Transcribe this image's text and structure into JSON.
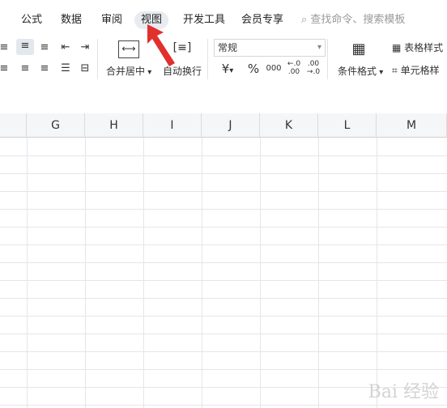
{
  "tabs": [
    {
      "label": "公式"
    },
    {
      "label": "数据"
    },
    {
      "label": "审阅"
    },
    {
      "label": "视图"
    },
    {
      "label": "开发工具"
    },
    {
      "label": "会员专享"
    }
  ],
  "search": {
    "placeholder": "查找命令、搜索模板"
  },
  "ribbon": {
    "merge_label": "合并居中",
    "wrap_label": "自动换行",
    "number_format": "常规",
    "currency_symbol": "¥",
    "percent_symbol": "%",
    "thousands_symbol": "000",
    "cond_format_label": "条件格式",
    "table_style_label": "表格样式",
    "cell_style_label": "单元格样"
  },
  "columns": [
    "G",
    "H",
    "I",
    "J",
    "K",
    "L",
    "M"
  ],
  "watermark": {
    "text": "Bai 经验"
  }
}
